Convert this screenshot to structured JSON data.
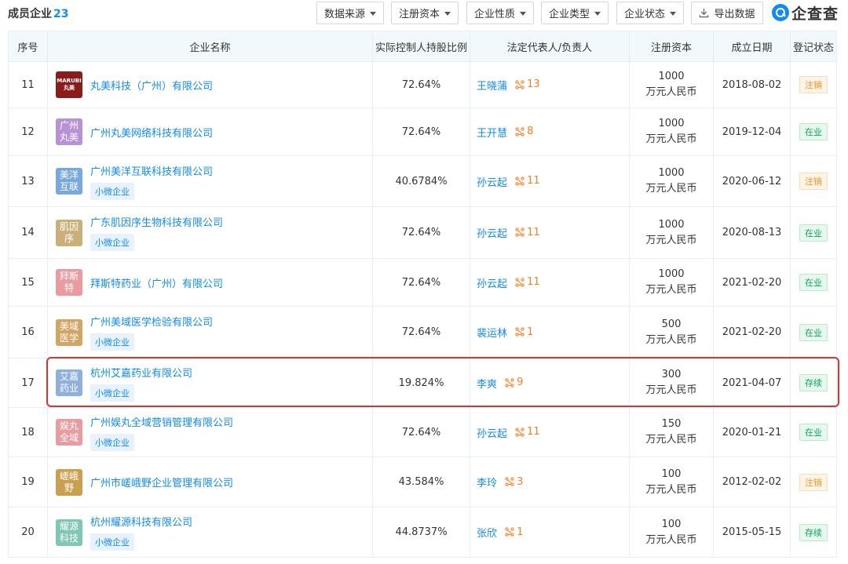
{
  "header": {
    "title": "成员企业",
    "count": "23",
    "filters": [
      "数据来源",
      "注册资本",
      "企业性质",
      "企业类型",
      "企业状态"
    ],
    "export_label": "导出数据",
    "logo_text": "企查查"
  },
  "table": {
    "columns": [
      "序号",
      "企业名称",
      "实际控制人持股比例",
      "法定代表人/负责人",
      "注册资本",
      "成立日期",
      "登记状态"
    ],
    "rows": [
      {
        "no": "11",
        "logo_text": "MARUBI 丸美",
        "logo_color": "#8b1c1c",
        "name": "丸美科技（广州）有限公司",
        "tag": "",
        "ratio": "72.64%",
        "person": "王晓蒲",
        "rel_count": "13",
        "capital_amount": "1000",
        "capital_unit": "万元人民币",
        "date": "2018-08-02",
        "status": "注销",
        "status_type": "cancel"
      },
      {
        "no": "12",
        "logo_text": "广州丸美",
        "logo_color": "#b792d6",
        "name": "广州丸美网络科技有限公司",
        "tag": "",
        "ratio": "72.64%",
        "person": "王开慧",
        "rel_count": "8",
        "capital_amount": "1000",
        "capital_unit": "万元人民币",
        "date": "2019-12-04",
        "status": "在业",
        "status_type": "active"
      },
      {
        "no": "13",
        "logo_text": "美洋互联",
        "logo_color": "#79a9dc",
        "name": "广州美洋互联科技有限公司",
        "tag": "小微企业",
        "ratio": "40.6784%",
        "person": "孙云起",
        "rel_count": "11",
        "capital_amount": "1000",
        "capital_unit": "万元人民币",
        "date": "2020-06-12",
        "status": "注销",
        "status_type": "cancel"
      },
      {
        "no": "14",
        "logo_text": "肌因序",
        "logo_color": "#c9b07a",
        "name": "广东肌因序生物科技有限公司",
        "tag": "小微企业",
        "ratio": "72.64%",
        "person": "孙云起",
        "rel_count": "11",
        "capital_amount": "1000",
        "capital_unit": "万元人民币",
        "date": "2020-08-13",
        "status": "在业",
        "status_type": "active"
      },
      {
        "no": "15",
        "logo_text": "拜斯特",
        "logo_color": "#e99ba0",
        "name": "拜斯特药业（广州）有限公司",
        "tag": "",
        "ratio": "72.64%",
        "person": "孙云起",
        "rel_count": "11",
        "capital_amount": "1000",
        "capital_unit": "万元人民币",
        "date": "2021-02-20",
        "status": "在业",
        "status_type": "active"
      },
      {
        "no": "16",
        "logo_text": "美域医学",
        "logo_color": "#d3a564",
        "name": "广州美域医学检验有限公司",
        "tag": "小微企业",
        "ratio": "72.64%",
        "person": "裴运林",
        "rel_count": "1",
        "capital_amount": "500",
        "capital_unit": "万元人民币",
        "date": "2021-02-20",
        "status": "在业",
        "status_type": "active"
      },
      {
        "no": "17",
        "logo_text": "艾嘉药业",
        "logo_color": "#8fb0dc",
        "name": "杭州艾嘉药业有限公司",
        "tag": "小微企业",
        "ratio": "19.824%",
        "person": "李爽",
        "rel_count": "9",
        "capital_amount": "300",
        "capital_unit": "万元人民币",
        "date": "2021-04-07",
        "status": "存续",
        "status_type": "exist"
      },
      {
        "no": "18",
        "logo_text": "娱丸全域",
        "logo_color": "#e99ba0",
        "name": "广州娱丸全域营销管理有限公司",
        "tag": "小微企业",
        "ratio": "72.64%",
        "person": "孙云起",
        "rel_count": "11",
        "capital_amount": "150",
        "capital_unit": "万元人民币",
        "date": "2020-01-21",
        "status": "在业",
        "status_type": "active"
      },
      {
        "no": "19",
        "logo_text": "嵯峨野",
        "logo_color": "#c9a04f",
        "name": "广州市嵯峨野企业管理有限公司",
        "tag": "",
        "ratio": "43.584%",
        "person": "李玲",
        "rel_count": "3",
        "capital_amount": "100",
        "capital_unit": "万元人民币",
        "date": "2012-02-02",
        "status": "注销",
        "status_type": "cancel"
      },
      {
        "no": "20",
        "logo_text": "耀源科技",
        "logo_color": "#7fc6b3",
        "name": "杭州耀源科技有限公司",
        "tag": "小微企业",
        "ratio": "44.8737%",
        "person": "张欣",
        "rel_count": "1",
        "capital_amount": "100",
        "capital_unit": "万元人民币",
        "date": "2015-05-15",
        "status": "存续",
        "status_type": "exist"
      }
    ]
  }
}
